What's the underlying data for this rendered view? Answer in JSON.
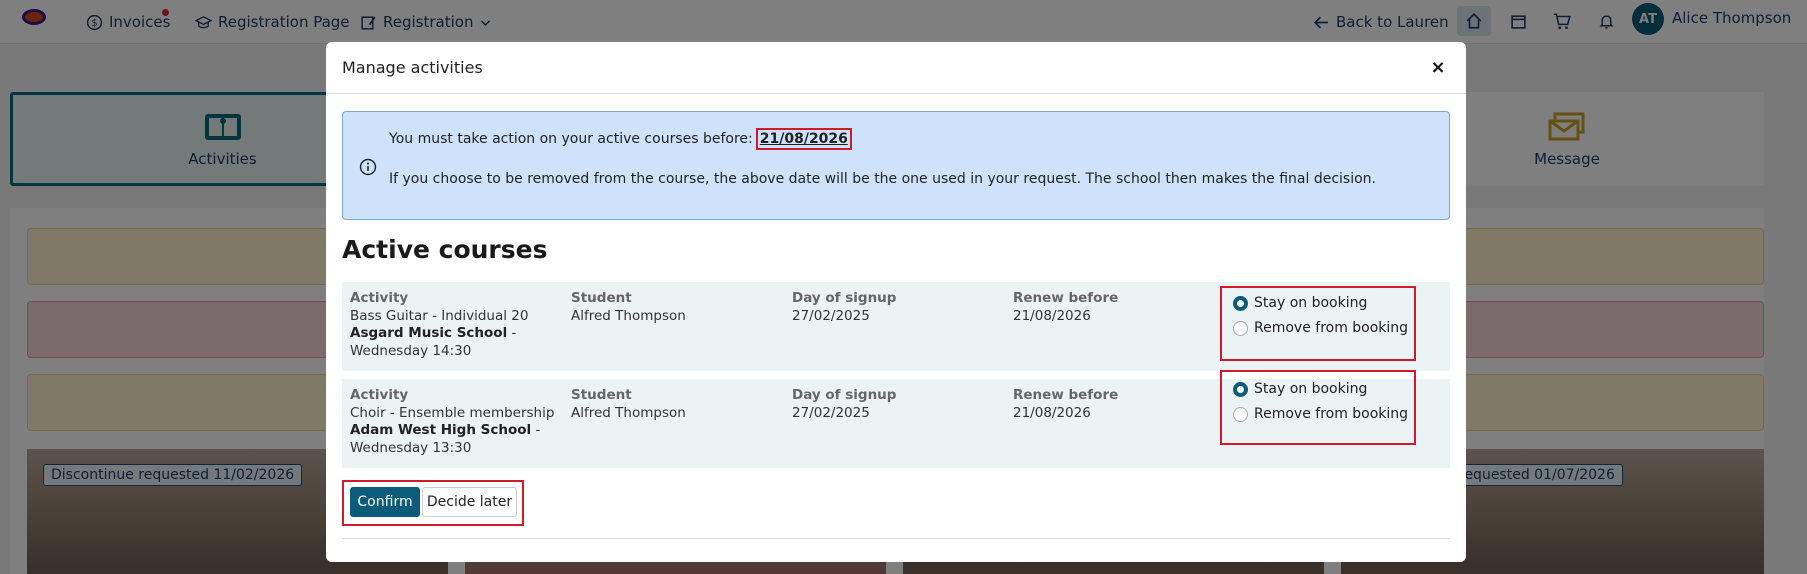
{
  "topnav": {
    "invoices_label": "Invoices",
    "registration_page_label": "Registration Page",
    "registration_label": "Registration",
    "back_label": "Back to Lauren",
    "user_initials": "AT",
    "user_name": "Alice Thompson"
  },
  "tiles": {
    "activities_label": "Activities",
    "message_label": "Message"
  },
  "background_badges": {
    "left": "Discontinue requested 11/02/2026",
    "right": "requested 01/07/2026"
  },
  "modal": {
    "title": "Manage activities",
    "close_symbol": "×",
    "info": {
      "line1": "You must take action on your active courses before:",
      "deadline": "21/08/2026",
      "line2": "If you choose to be removed from the course, the above date will be the one used in your request. The school then makes the final decision."
    },
    "section_title": "Active courses",
    "column_labels": {
      "activity": "Activity",
      "student": "Student",
      "signup": "Day of signup",
      "renew": "Renew before"
    },
    "courses": [
      {
        "activity": "Bass Guitar - Individual 20",
        "school": "Asgard Music School",
        "time_prefix": " -",
        "time": "Wednesday 14:30",
        "student": "Alfred Thompson",
        "signup": "27/02/2025",
        "renew": "21/08/2026",
        "stay_label": "Stay on booking",
        "remove_label": "Remove from booking",
        "selected": "stay"
      },
      {
        "activity": "Choir - Ensemble membership",
        "school": "Adam West High School",
        "time_prefix": " -",
        "time": "Wednesday 13:30",
        "student": "Alfred Thompson",
        "signup": "27/02/2025",
        "renew": "21/08/2026",
        "stay_label": "Stay on booking",
        "remove_label": "Remove from booking",
        "selected": "stay"
      }
    ],
    "buttons": {
      "confirm": "Confirm",
      "decide_later": "Decide later"
    }
  },
  "colors": {
    "primary": "#0b5c7a",
    "highlight_box": "#d01c2a",
    "info_bg": "#cfe2fb"
  }
}
